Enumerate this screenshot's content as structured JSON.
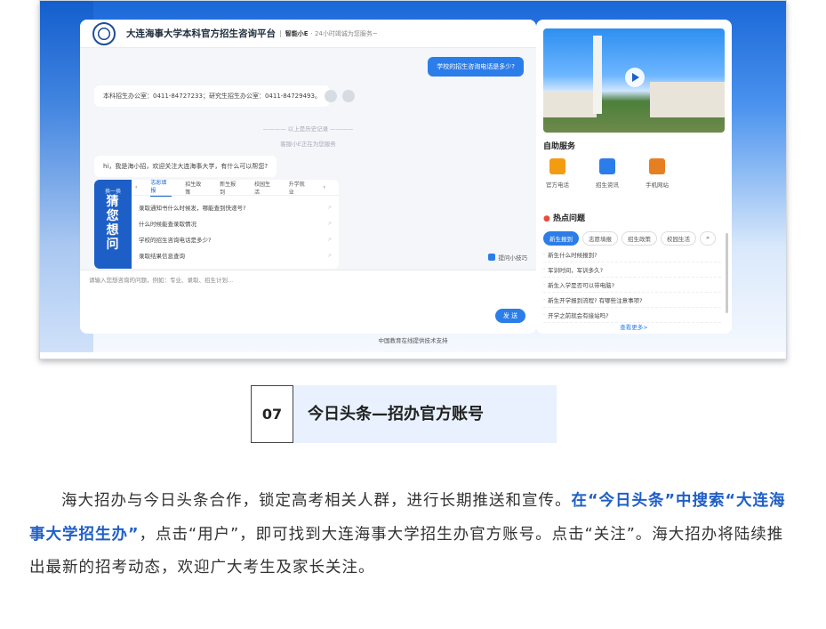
{
  "screenshot": {
    "chat": {
      "title": "大连海事大学本科官方招生咨询平台",
      "sep": "|",
      "brand": "智能小E",
      "subtitle": "· 24小时竭诚为您服务~",
      "user_message": "学校的招生咨询电话是多少?",
      "bot_reply": "本科招生办公室：0411-84727233；研究生招生办公室：0411-84729493。",
      "history_divider": "———— 以上是历史记录 ————",
      "agent_status": "客服小E正在为您服务",
      "greeting": "hi，我是海小招，欢迎关注大连海事大学，有什么可以帮您?",
      "guess": {
        "refresh": "换一换",
        "side_chars": [
          "猜",
          "您",
          "想",
          "问"
        ],
        "tabs": [
          "志愿填报",
          "招生政策",
          "新生报到",
          "校园生活",
          "升学就业"
        ],
        "prev_arrow": "‹",
        "next_arrow": "›",
        "questions": [
          "录取通知书什么时候发，哪能查到快递号?",
          "什么时候能查录取情况",
          "学校的招生咨询电话是多少?",
          "录取结果信息查询"
        ]
      },
      "tips": "提问小技巧",
      "input_placeholder": "请输入您想咨询的问题，例如：专业、录取、招生计划...",
      "send": "发 送"
    },
    "right": {
      "self_service_title": "自助服务",
      "services": [
        {
          "label": "官方电话",
          "color": "#f39c12",
          "icon": "phone-icon"
        },
        {
          "label": "招生资讯",
          "color": "#2b7de9",
          "icon": "document-icon"
        },
        {
          "label": "手机网站",
          "color": "#e67e22",
          "icon": "html5-icon"
        }
      ],
      "hot_title": "热点问题",
      "hot_tabs": [
        "新生报到",
        "志愿填报",
        "招生政策",
        "校园生活"
      ],
      "hot_next": "»",
      "hot_questions": [
        "新生什么时候报到?",
        "军训时间，军训多久?",
        "新生入学是否可以带电脑?",
        "新生开学报到流程? 有哪些注意事项?",
        "开学之前就会有接站吗?"
      ],
      "more": "查看更多>"
    },
    "footer": "中国教育在线提供技术支持"
  },
  "section": {
    "number": "07",
    "title": "今日头条—招办官方账号"
  },
  "paragraph": {
    "part1": "海大招办与今日头条合作，锁定高考相关人群，进行长期推送和宣传。",
    "highlight": "在“今日头条”中搜索“大连海事大学招生办”",
    "part2": "，点击“用户”，即可找到大连海事大学招生办官方账号。点击“关注”。海大招办将陆续推出最新的招考动态，欢迎广大考生及家长关注。"
  }
}
